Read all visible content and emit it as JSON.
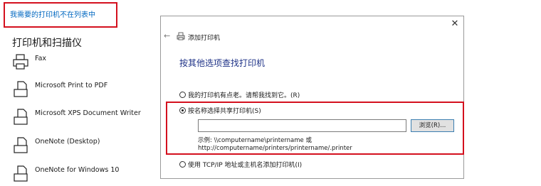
{
  "settings": {
    "missing_printer_link": "我需要的打印机不在列表中",
    "section_title": "打印机和扫描仪",
    "printers": [
      {
        "name": "Fax",
        "icon": "fax-icon"
      },
      {
        "name": "Microsoft Print to PDF",
        "icon": "printer-document-icon"
      },
      {
        "name": "Microsoft XPS Document Writer",
        "icon": "printer-document-icon"
      },
      {
        "name": "OneNote (Desktop)",
        "icon": "printer-document-icon"
      },
      {
        "name": "OneNote for Windows 10",
        "icon": "printer-document-icon"
      }
    ]
  },
  "dialog": {
    "close_label": "✕",
    "back_label": "←",
    "title": "添加打印机",
    "heading": "按其他选项查找打印机",
    "options": {
      "old_printer": "我的打印机有点老。请帮我找到它。(R)",
      "shared_by_name": "按名称选择共享打印机(S)",
      "tcpip": "使用 TCP/IP 地址或主机名添加打印机(I)"
    },
    "name_field_value": "",
    "browse_label": "浏览(R)...",
    "example_line1": "示例: \\\\computername\\printername 或",
    "example_line2": "http://computername/printers/printername/.printer"
  },
  "colors": {
    "highlight_red": "#d4101e",
    "link_blue": "#0067c0",
    "heading_blue": "#1e3287"
  }
}
